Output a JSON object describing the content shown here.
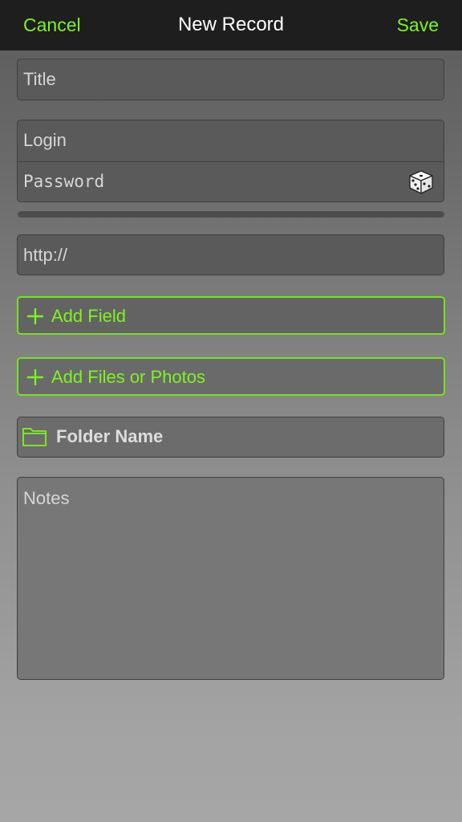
{
  "navbar": {
    "cancel_label": "Cancel",
    "title": "New Record",
    "save_label": "Save"
  },
  "form": {
    "title_placeholder": "Title",
    "login_placeholder": "Login",
    "password_placeholder": "Password",
    "url_placeholder": "http://",
    "add_field_label": "Add Field",
    "add_files_label": "Add Files or Photos",
    "folder_label": "Folder Name",
    "notes_placeholder": "Notes"
  },
  "icons": {
    "generate_password": "dice-icon",
    "add": "plus-icon",
    "folder": "folder-icon"
  },
  "colors": {
    "accent": "#7cf51f",
    "navbar": "#1e1e1e"
  }
}
